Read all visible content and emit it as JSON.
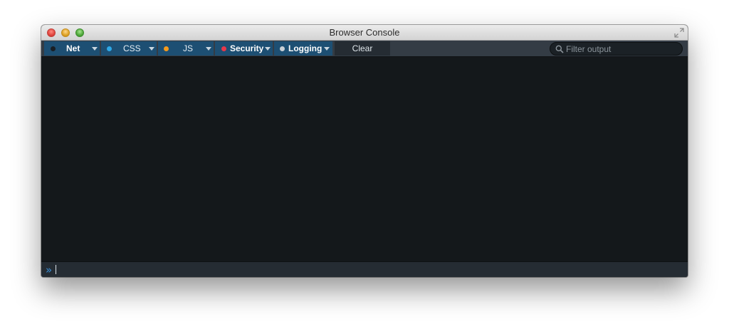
{
  "window": {
    "title": "Browser Console"
  },
  "toolbar": {
    "filters": [
      {
        "label": "Net",
        "dot_color": "#1a1f24",
        "icon": "dot-icon"
      },
      {
        "label": "CSS",
        "dot_color": "#2ea8e6",
        "icon": "dot-icon"
      },
      {
        "label": "JS",
        "dot_color": "#f59a1c",
        "icon": "dot-icon"
      },
      {
        "label": "Security",
        "dot_color": "#e8384a",
        "icon": "dot-icon"
      },
      {
        "label": "Logging",
        "dot_color": "#c9d0d6",
        "icon": "dot-icon"
      }
    ],
    "clear_label": "Clear",
    "filter_placeholder": "Filter output",
    "filter_value": ""
  },
  "console": {
    "prompt_symbol": "»"
  },
  "colors": {
    "toolbar_bg": "#343c45",
    "filter_active_bg": "#1d4f73",
    "output_bg": "#14181b",
    "prompt_color": "#3a8fd6"
  }
}
